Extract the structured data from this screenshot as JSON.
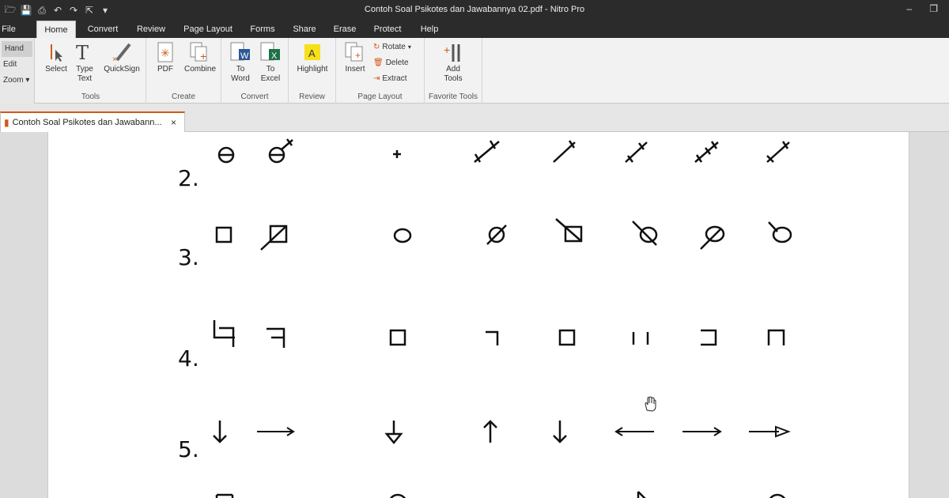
{
  "window": {
    "title": "Contoh Soal Psikotes dan Jawabannya 02.pdf - Nitro Pro"
  },
  "menu": {
    "file": "File",
    "tabs": [
      "Home",
      "Convert",
      "Review",
      "Page Layout",
      "Forms",
      "Share",
      "Erase",
      "Protect",
      "Help"
    ]
  },
  "mode": {
    "hand": "Hand",
    "edit": "Edit",
    "zoom": "Zoom"
  },
  "ribbon": {
    "tools": {
      "label": "Tools",
      "select": "Select",
      "type_text": "Type\nText",
      "quicksign": "QuickSign"
    },
    "create": {
      "label": "Create",
      "pdf": "PDF",
      "combine": "Combine"
    },
    "convert": {
      "label": "Convert",
      "to_word": "To\nWord",
      "to_excel": "To\nExcel"
    },
    "review": {
      "label": "Review",
      "highlight": "Highlight"
    },
    "page_layout": {
      "label": "Page Layout",
      "insert": "Insert",
      "rotate": "Rotate",
      "delete": "Delete",
      "extract": "Extract"
    },
    "favorite": {
      "label": "Favorite Tools",
      "add_tools": "Add\nTools"
    }
  },
  "document_tab": {
    "name": "Contoh Soal Psikotes dan Jawabann...",
    "close": "×"
  },
  "questions": [
    {
      "number": "2."
    },
    {
      "number": "3."
    },
    {
      "number": "4."
    },
    {
      "number": "5."
    }
  ],
  "colors": {
    "accent": "#d05a1a",
    "titlebar": "#2b2b2b"
  }
}
